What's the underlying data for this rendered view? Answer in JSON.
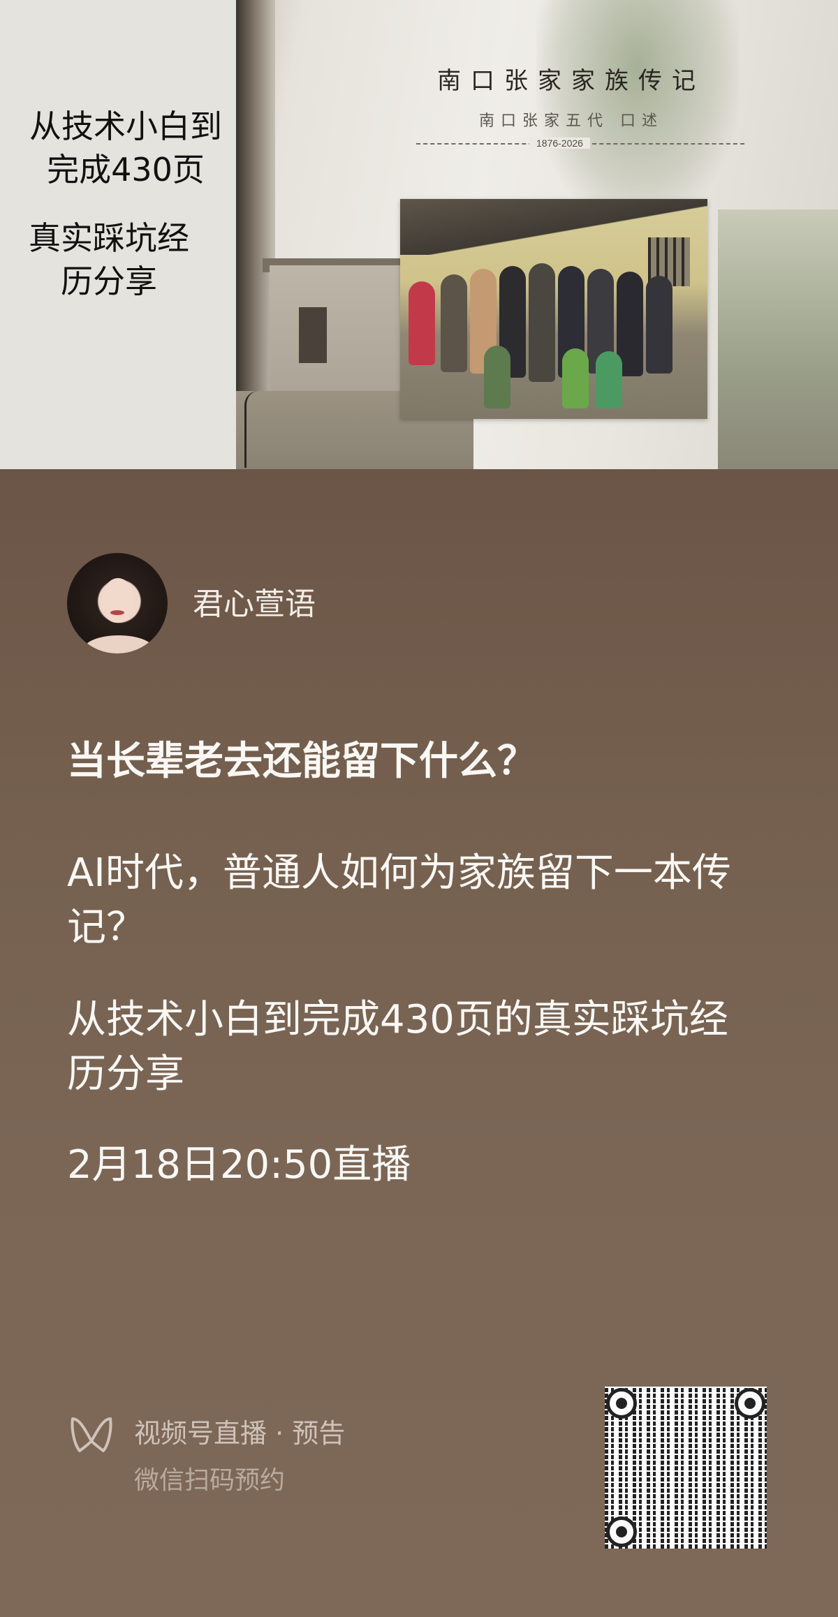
{
  "cover": {
    "caption_line1": "从技术小白到完成430页",
    "caption_line2": "真实踩坑经历分享",
    "book_title": "南口张家家族传记",
    "book_subtitle": "南口张家五代    口述",
    "book_years": "1876-2026"
  },
  "author": {
    "name": "君心萱语",
    "avatar_icon": "author-avatar"
  },
  "post": {
    "question": "当长辈老去还能留下什么？",
    "line2": "AI时代，普通人如何为家族留下一本传记？",
    "line3": "从技术小白到完成430页的真实踩坑经历分享",
    "schedule": "2月18日20:50直播"
  },
  "footer": {
    "channel_label": "视频号直播 · 预告",
    "scan_hint": "微信扫码预约",
    "logo_icon": "channels-logo-icon",
    "qr_icon": "qr-code"
  },
  "colors": {
    "background": "#6e5a4e",
    "text_primary": "#fbf8f5",
    "text_secondary": "#cfc3b9"
  }
}
